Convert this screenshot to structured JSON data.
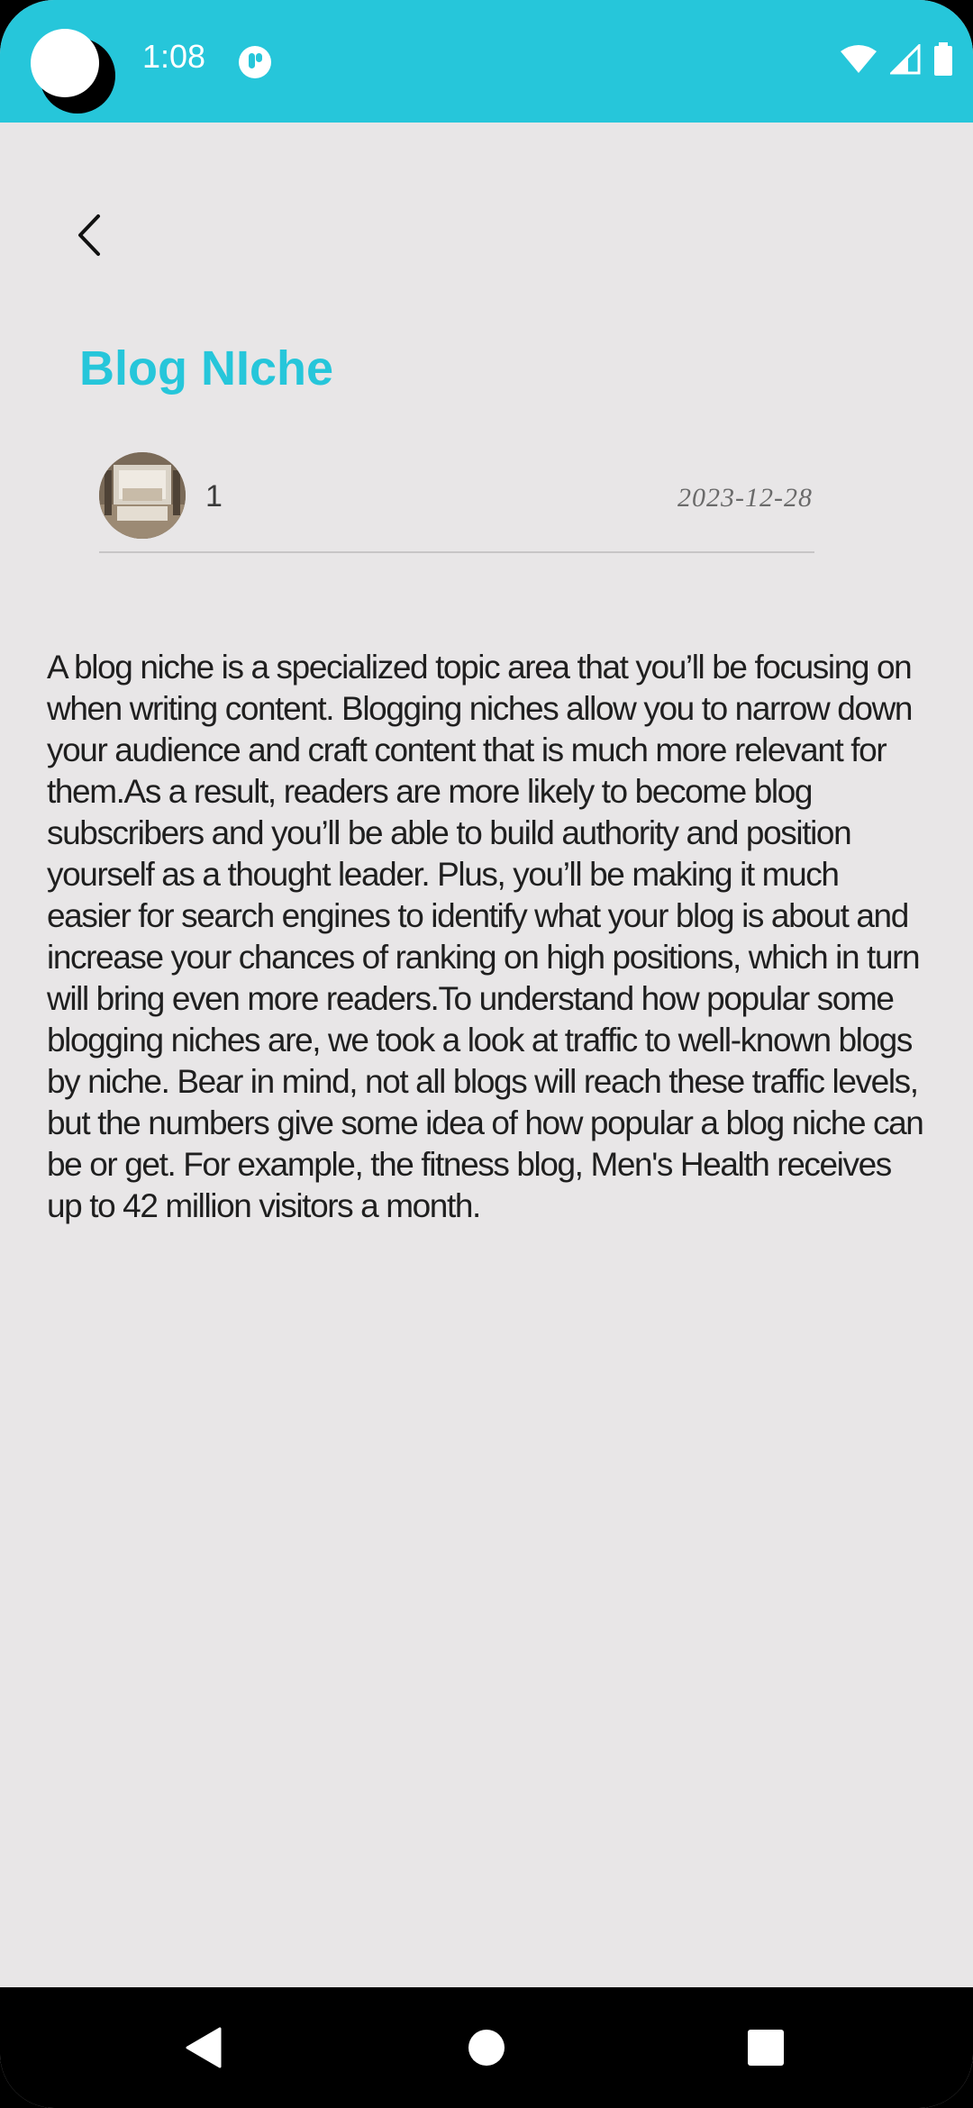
{
  "status_bar": {
    "time": "1:08",
    "background_color": "#26c6da"
  },
  "header": {
    "back_icon": "chevron-left-icon"
  },
  "post": {
    "title": "Blog NIche",
    "title_color": "#26c6da",
    "author": "1",
    "date": "2023-12-28",
    "body": "A blog niche is a specialized topic area that you’ll be focusing on when writing content. Blogging niches allow you to narrow down your audience and craft content that is much more relevant for them.As a result, readers are more likely to become blog subscribers and you’ll be able to build authority and position yourself as a thought leader. Plus, you’ll be making it much easier for search engines to identify what your blog is about and increase your chances of ranking on high positions, which in turn will bring even more readers.To understand how popular some blogging niches are, we took a look at traffic to well-known blogs by niche. Bear in mind, not all blogs will reach these traffic levels, but the numbers give some idea of how popular a blog niche can be or get. For example, the fitness blog, Men's Health receives up to 42 million visitors a month."
  },
  "nav_bar": {
    "back_icon": "triangle-back-icon",
    "home_icon": "circle-home-icon",
    "recents_icon": "square-recents-icon"
  }
}
